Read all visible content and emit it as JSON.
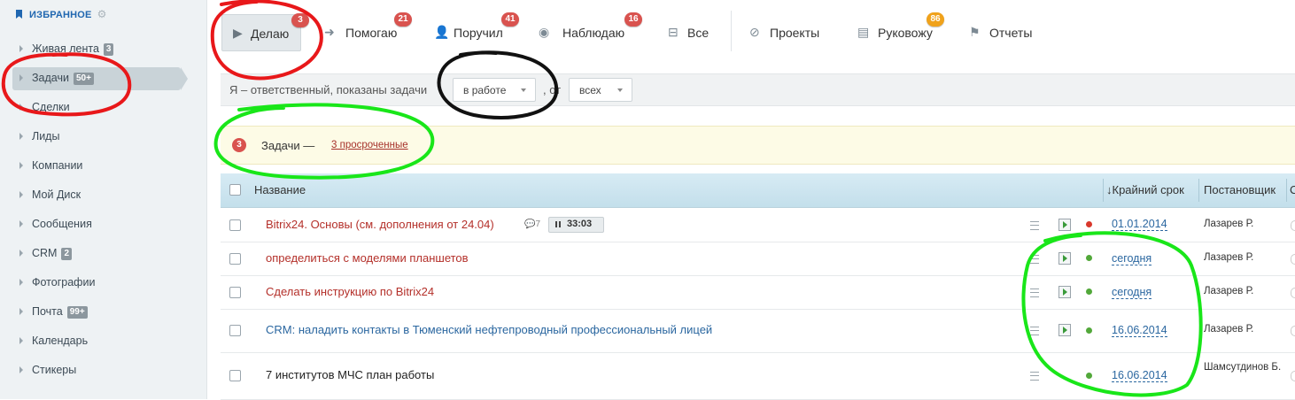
{
  "sidebar": {
    "favorites_title": "ИЗБРАННОЕ",
    "items": [
      {
        "label": "Живая лента",
        "badge": "3"
      },
      {
        "label": "Задачи",
        "badge": "50+"
      },
      {
        "label": "Сделки",
        "badge": ""
      },
      {
        "label": "Лиды",
        "badge": ""
      },
      {
        "label": "Компании",
        "badge": ""
      },
      {
        "label": "Мой Диск",
        "badge": ""
      },
      {
        "label": "Сообщения",
        "badge": ""
      },
      {
        "label": "CRM",
        "badge": "2"
      },
      {
        "label": "Фотографии",
        "badge": ""
      },
      {
        "label": "Почта",
        "badge": "99+"
      },
      {
        "label": "Календарь",
        "badge": ""
      },
      {
        "label": "Стикеры",
        "badge": ""
      }
    ]
  },
  "tabs": [
    {
      "label": "Делаю",
      "count": "3",
      "icon": "play-icon"
    },
    {
      "label": "Помогаю",
      "count": "21",
      "icon": "arrow-right-icon"
    },
    {
      "label": "Поручил",
      "count": "41",
      "icon": "person-icon"
    },
    {
      "label": "Наблюдаю",
      "count": "16",
      "icon": "eye-icon"
    },
    {
      "label": "Все",
      "count": "",
      "icon": "inbox-icon"
    },
    {
      "label": "Проекты",
      "count": "",
      "icon": "compass-icon"
    },
    {
      "label": "Руковожу",
      "count": "86",
      "icon": "notebook-icon"
    },
    {
      "label": "Отчеты",
      "count": "",
      "icon": "flag-icon"
    }
  ],
  "filter": {
    "text_before": "Я – ответственный, показаны задачи",
    "status_value": "в работе",
    "text_between": ", от",
    "from_value": "всех"
  },
  "notice": {
    "count": "3",
    "text": "Задачи —",
    "link": "3 просроченные"
  },
  "table": {
    "headers": {
      "name": "Название",
      "deadline": "↓Крайний срок",
      "creator": "Постановщик",
      "extra": "С"
    },
    "rows": [
      {
        "title": "Bitrix24. Основы (см. дополнения от 24.04)",
        "comments": "7",
        "timer": "33:03",
        "deadline": "01.01.2014",
        "creator": "Лазарев Р.",
        "status_color": "#d9382c"
      },
      {
        "title": "определиться с моделями планшетов",
        "comments": "",
        "timer": "",
        "deadline": "сегодня",
        "creator": "Лазарев Р.",
        "status_color": "#52a83a"
      },
      {
        "title": "Сделать инструкцию по Bitrix24",
        "comments": "",
        "timer": "",
        "deadline": "сегодня",
        "creator": "Лазарев Р.",
        "status_color": "#52a83a"
      },
      {
        "title": "CRM: наладить контакты в Тюменский нефтепроводный профессиональный лицей",
        "comments": "",
        "timer": "",
        "deadline": "16.06.2014",
        "creator": "Лазарев Р.",
        "status_color": "#52a83a"
      },
      {
        "title": "7 институтов МЧС план работы",
        "comments": "",
        "timer": "",
        "deadline": "16.06.2014",
        "creator": "Шамсутдинов Б.",
        "status_color": "#52a83a"
      }
    ]
  },
  "colors": {
    "annotation_red": "#e8181a",
    "annotation_black": "#111111",
    "annotation_green": "#19e619"
  }
}
